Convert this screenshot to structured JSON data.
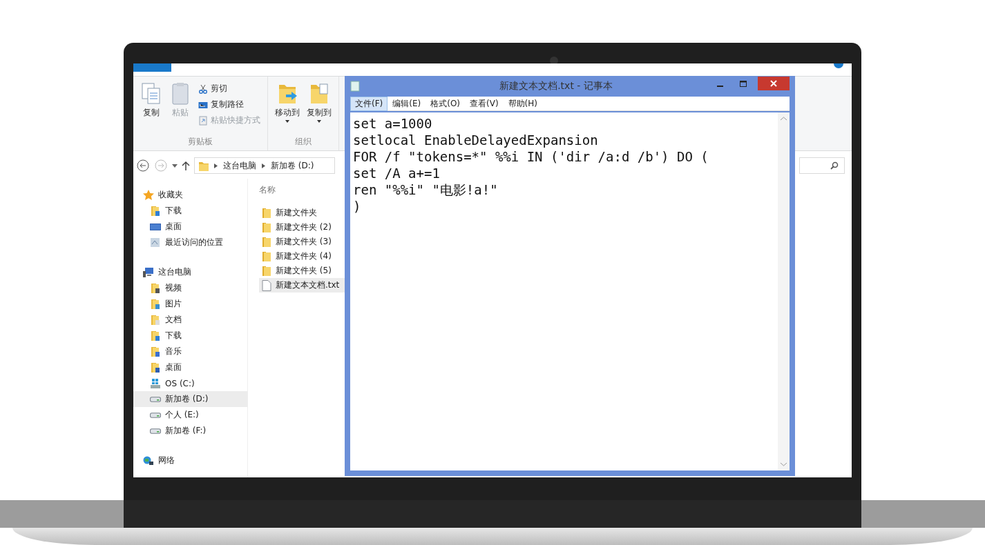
{
  "ribbon": {
    "groups": [
      {
        "label": "剪贴板",
        "large_buttons": [
          {
            "label": "复制",
            "kind": "copy",
            "disabled": false
          },
          {
            "label": "粘贴",
            "kind": "paste",
            "disabled": true
          }
        ],
        "small_buttons": [
          {
            "label": "剪切",
            "kind": "cut",
            "disabled": false
          },
          {
            "label": "复制路径",
            "kind": "path",
            "disabled": false
          },
          {
            "label": "粘贴快捷方式",
            "kind": "shortcut",
            "disabled": true
          }
        ]
      },
      {
        "label": "组织",
        "large_buttons": [
          {
            "label": "移动到",
            "kind": "move",
            "disabled": false
          },
          {
            "label": "复制到",
            "kind": "copyto",
            "disabled": false
          }
        ]
      }
    ]
  },
  "address": {
    "crumbs": [
      "这台电脑",
      "新加卷 (D:)"
    ]
  },
  "sidebar": {
    "groups": [
      {
        "label": "收藏夹",
        "kind": "star",
        "children": [
          {
            "label": "下载",
            "kind": "download",
            "selected": false
          },
          {
            "label": "桌面",
            "kind": "desktop",
            "selected": false
          },
          {
            "label": "最近访问的位置",
            "kind": "recent",
            "selected": false
          }
        ]
      },
      {
        "label": "这台电脑",
        "kind": "pc",
        "children": [
          {
            "label": "视频",
            "kind": "video",
            "selected": false
          },
          {
            "label": "图片",
            "kind": "pictures",
            "selected": false
          },
          {
            "label": "文档",
            "kind": "documents",
            "selected": false
          },
          {
            "label": "下载",
            "kind": "download",
            "selected": false
          },
          {
            "label": "音乐",
            "kind": "music",
            "selected": false
          },
          {
            "label": "桌面",
            "kind": "desktopfolder",
            "selected": false
          },
          {
            "label": "OS (C:)",
            "kind": "osdrive",
            "selected": false
          },
          {
            "label": "新加卷 (D:)",
            "kind": "drive",
            "selected": true
          },
          {
            "label": "个人 (E:)",
            "kind": "drive",
            "selected": false
          },
          {
            "label": "新加卷 (F:)",
            "kind": "drive",
            "selected": false
          }
        ]
      },
      {
        "label": "网络",
        "kind": "network"
      }
    ]
  },
  "files": {
    "column": "名称",
    "items": [
      {
        "name": "新建文件夹",
        "kind": "folder",
        "selected": false
      },
      {
        "name": "新建文件夹 (2)",
        "kind": "folder",
        "selected": false
      },
      {
        "name": "新建文件夹 (3)",
        "kind": "folder",
        "selected": false
      },
      {
        "name": "新建文件夹 (4)",
        "kind": "folder",
        "selected": false
      },
      {
        "name": "新建文件夹 (5)",
        "kind": "folder",
        "selected": false
      },
      {
        "name": "新建文本文档.txt",
        "kind": "text",
        "selected": true
      }
    ]
  },
  "notepad": {
    "title": "新建文本文档.txt - 记事本",
    "menu": [
      {
        "label": "文件(F)",
        "selected": true
      },
      {
        "label": "编辑(E)",
        "selected": false
      },
      {
        "label": "格式(O)",
        "selected": false
      },
      {
        "label": "查看(V)",
        "selected": false
      },
      {
        "label": "帮助(H)",
        "selected": false
      }
    ],
    "lines": [
      "set a=1000",
      "setlocal EnableDelayedExpansion",
      "FOR /f \"tokens=*\" %%i IN ('dir /a:d /b') DO (",
      "set /A a+=1",
      "ren \"%%i\" \"电影!a!\"",
      ")"
    ]
  }
}
